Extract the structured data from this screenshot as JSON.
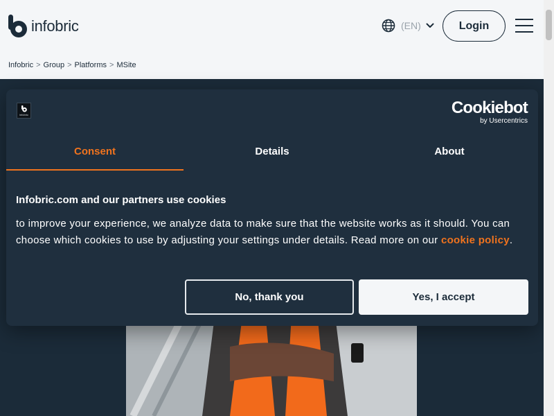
{
  "header": {
    "logo_text": "infobric",
    "language_code": "(EN)",
    "login_label": "Login",
    "globe_icon": "globe-icon",
    "chevron_icon": "chevron-down-icon",
    "menu_icon": "hamburger-menu-icon"
  },
  "breadcrumb": {
    "items": [
      "Infobric",
      "Group",
      "Platforms",
      "MSite"
    ],
    "separator": ">"
  },
  "cookie_dialog": {
    "logo_text": "infobric",
    "brand_name": "Cookiebot",
    "brand_sub": "by Usercentrics",
    "tabs": [
      {
        "label": "Consent",
        "active": true
      },
      {
        "label": "Details",
        "active": false
      },
      {
        "label": "About",
        "active": false
      }
    ],
    "title": "Infobric.com and our partners use cookies",
    "body_text": "to improve your experience, we analyze data to make sure that the website works as it should. You can choose which cookies to use by adjusting your settings under details. Read more on our",
    "link_text": "cookie policy",
    "body_end": ".",
    "decline_label": "No, thank you",
    "accept_label": "Yes, I accept"
  },
  "colors": {
    "primary_dark": "#1b2b39",
    "accent_orange": "#f0731e",
    "light_bg": "#f4f6f8"
  }
}
